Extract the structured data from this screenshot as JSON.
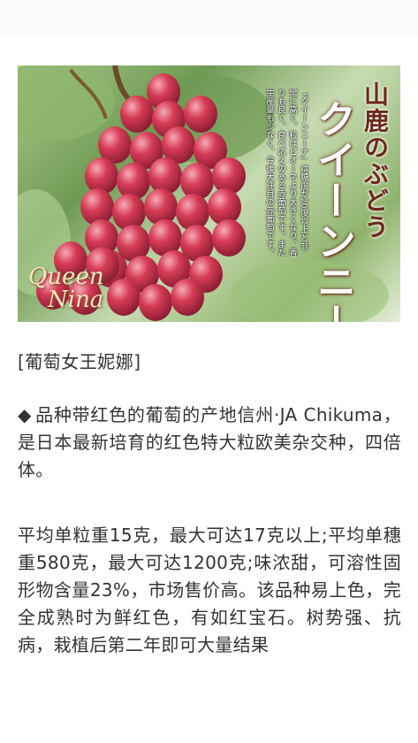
{
  "hero": {
    "brand_vertical": "山鹿のぶどう",
    "variety_vertical": "クイーンニーナ",
    "description_vertical": "「クイーンニーナ」は糖度が20度以上と非常に高く、粒はピオーネより大きくなり、香りも良く、食べ応えのある赤葡萄です。また生産量も少なく、今後大注目の赤葡萄です。",
    "logo_en_line1": "Queen",
    "logo_en_line2": "Nina"
  },
  "caption": "[葡萄女王妮娜]",
  "paragraph1": {
    "bullet": "◆",
    "text": "品种带红色的葡萄的产地信州·JA Chikuma，是日本最新培育的红色特大粒欧美杂交种，四倍体。"
  },
  "paragraph2": {
    "text": "平均单粒重15克，最大可达17克以上;平均单穗重580克，最大可达1200克;味浓甜，可溶性固形物含量23%，市场售价高。该品种易上色，完全成熟时为鲜红色，有如红宝石。树势强、抗病，栽植后第二年即可大量结果"
  },
  "colors": {
    "grape": "#d63b55",
    "grape_highlight": "#f7a9b6",
    "leaf": "#7fa85f",
    "brand_brown": "#6b2a1a"
  }
}
